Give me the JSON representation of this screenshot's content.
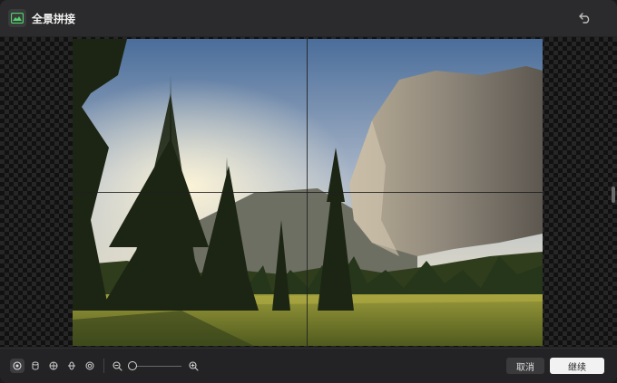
{
  "window": {
    "title": "全景拼接"
  },
  "header": {
    "app_icon": "panorama-icon",
    "undo_icon": "undo-icon"
  },
  "canvas": {
    "image_description_icons": [
      "sky",
      "cliff",
      "pines",
      "meadow"
    ],
    "grid": "2x2"
  },
  "toolbar": {
    "tools": [
      {
        "icon": "sphere-view-icon",
        "active": true
      },
      {
        "icon": "cylinder-view-icon",
        "active": false
      },
      {
        "icon": "globe-view-icon",
        "active": false
      },
      {
        "icon": "mercator-view-icon",
        "active": false
      },
      {
        "icon": "target-view-icon",
        "active": false
      }
    ],
    "zoom_out_icon": "zoom-out-icon",
    "zoom_in_icon": "zoom-in-icon",
    "zoom_level": 0.0,
    "cancel_label": "取消",
    "continue_label": "继续"
  },
  "colors": {
    "background": "#232325",
    "titlebar": "#2b2b2d",
    "accent": "#f2f2f2"
  }
}
